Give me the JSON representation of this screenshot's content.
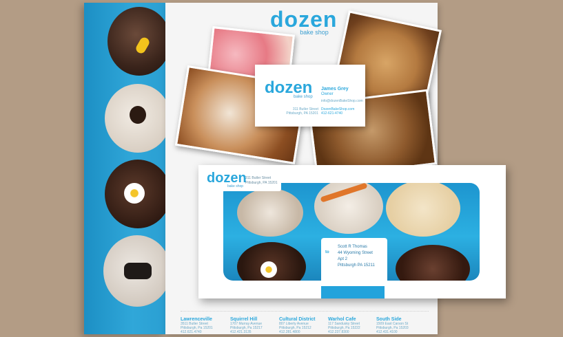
{
  "brand": {
    "name": "dozen",
    "tagline": "bake shop"
  },
  "business_card": {
    "name": "James Grey",
    "title": "Owner",
    "email": "info@dozenBakeShop.com",
    "address_line1": "311 Butler Street",
    "address_line2": "Pittsburgh, PA 15201",
    "website": "DozenBakeShop.com",
    "phone": "412-621-4740"
  },
  "envelope": {
    "return_line1": "311 Butler Street",
    "return_line2": "Pittsburgh, PA 15201",
    "to_label": "to",
    "recipient": [
      "Scott R Thomas",
      "44 Wyoming Street",
      "Apt 2",
      "Pittsburgh PA 15211"
    ]
  },
  "locations": [
    {
      "name": "Lawrenceville",
      "street": "3511 Butler Street",
      "city": "Pittsburgh, Pa 15201",
      "phone": "412.621.4740"
    },
    {
      "name": "Squirrel Hill",
      "street": "1707 Murray Avenue",
      "city": "Pittsburgh, Pa 15217",
      "phone": "412.421.3135"
    },
    {
      "name": "Cultural District",
      "street": "807 Liberty Avenue",
      "city": "Pittsburgh, Pa 15212",
      "phone": "412.281.4800"
    },
    {
      "name": "Warhol Cafe",
      "street": "117 Sandusky Street",
      "city": "Pittsburgh, Pa 15222",
      "phone": "412.237.8300"
    },
    {
      "name": "South Side",
      "street": "1509 East Carson St",
      "city": "Pittsburgh, Pa 15203",
      "phone": "412.431.4100"
    }
  ],
  "colors": {
    "accent": "#2aa7dc",
    "background": "#b39c85",
    "panel": "#f5f5f5"
  }
}
